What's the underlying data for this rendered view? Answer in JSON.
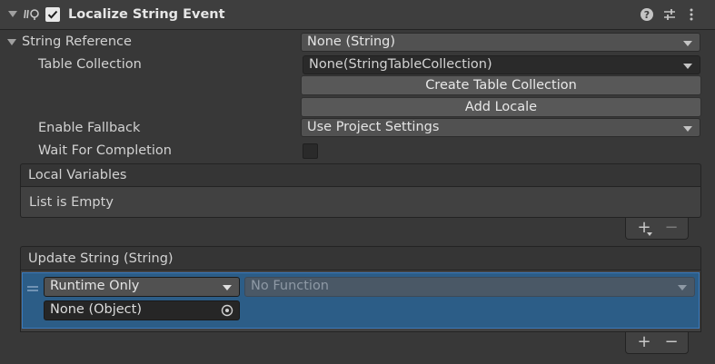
{
  "component": {
    "title": "Localize String Event",
    "enabled": true,
    "icons": [
      "script-icon",
      "help-icon",
      "presets-icon",
      "kebab-menu-icon"
    ]
  },
  "string_reference": {
    "label": "String Reference",
    "value": "None (String)",
    "table_collection": {
      "label": "Table Collection",
      "value": "None(StringTableCollection)"
    },
    "create_table_collection_label": "Create Table Collection",
    "add_locale_label": "Add Locale",
    "enable_fallback": {
      "label": "Enable Fallback",
      "value": "Use Project Settings"
    },
    "wait_for_completion": {
      "label": "Wait For Completion",
      "checked": false
    }
  },
  "local_variables": {
    "header": "Local Variables",
    "empty_text": "List is Empty",
    "add_symbol": "+",
    "remove_symbol": "−"
  },
  "update_string": {
    "header": "Update String (String)",
    "row": {
      "runtime_mode": "Runtime Only",
      "function": "No Function",
      "object": "None (Object)"
    },
    "add_symbol": "+",
    "remove_symbol": "−"
  },
  "colors": {
    "panel_bg": "#383838",
    "selection_blue": "#2c5d87",
    "selection_border": "#3a79bb"
  }
}
